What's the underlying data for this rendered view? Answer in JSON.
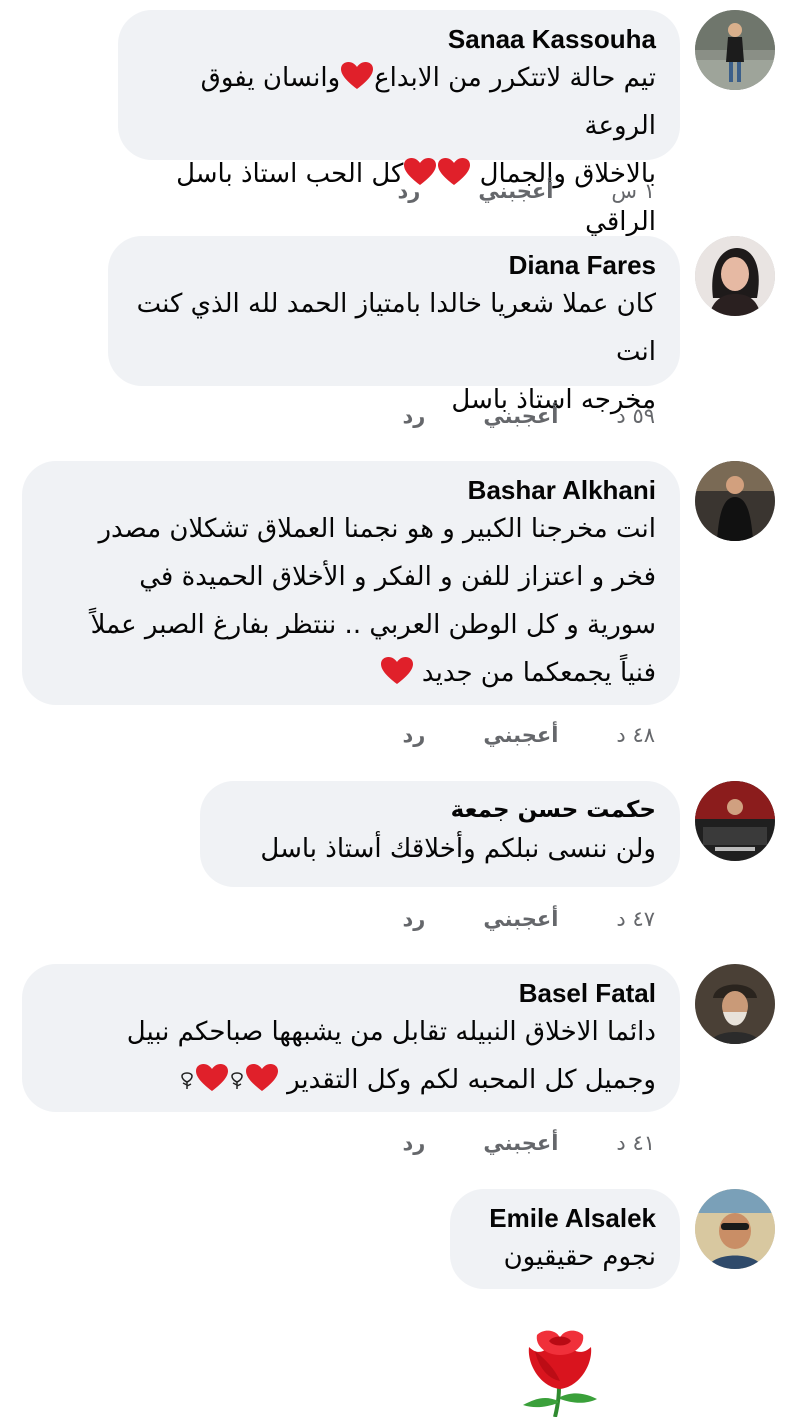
{
  "comments": [
    {
      "author": "Sanaa Kassouha",
      "lines": [
        [
          "تيم حالة لاتتكرر من الابداع",
          "heart",
          "وانسان يفوق الروعة"
        ],
        [
          "بالاخلاق والجمال ",
          "heart",
          "heart",
          "كل الحب استاذ باسل الراقي"
        ]
      ],
      "time": "١ س",
      "like_label": "أعجبني",
      "reply_label": "رد"
    },
    {
      "author": "Diana Fares",
      "lines": [
        [
          "كان عملا شعريا خالدا بامتياز الحمد لله الذي كنت انت"
        ],
        [
          "مخرجه استاذ باسل"
        ]
      ],
      "time": "٥٩ د",
      "like_label": "أعجبني",
      "reply_label": "رد"
    },
    {
      "author": "Bashar Alkhani",
      "lines": [
        [
          "انت مخرجنا الكبير و هو نجمنا العملاق تشكلان مصدر"
        ],
        [
          "فخر و اعتزاز  للفن و الفكر و الأخلاق الحميدة في"
        ],
        [
          "سورية و كل الوطن العربي  .. ننتظر بفارغ الصبر عملاً"
        ],
        [
          "فنياً يجمعكما من جديد ",
          "heart"
        ]
      ],
      "time": "٤٨ د",
      "like_label": "أعجبني",
      "reply_label": "رد"
    },
    {
      "author": "حكمت حسن جمعة",
      "lines": [
        [
          "ولن ننسى نبلكم وأخلاقك أستاذ باسل"
        ]
      ],
      "time": "٤٧ د",
      "like_label": "أعجبني",
      "reply_label": "رد"
    },
    {
      "author": "Basel Fatal",
      "lines": [
        [
          "دائما الاخلاق النبيله تقابل من يشبهها صباحكم نبيل"
        ],
        [
          "وجميل كل المحبه لكم وكل التقدير ",
          "heart",
          "rose",
          "heart",
          "rose"
        ]
      ],
      "time": "٤١ د",
      "like_label": "أعجبني",
      "reply_label": "رد"
    },
    {
      "author": "Emile Alsalek",
      "lines": [
        [
          "نجوم حقيقيون"
        ]
      ]
    }
  ],
  "colors": {
    "bubble": "#f0f2f5",
    "text": "#050505",
    "meta": "#65676b",
    "heart": "#e0202a"
  },
  "icons": [
    "heart-emoji",
    "rose-emoji",
    "red-rose-sticker"
  ]
}
